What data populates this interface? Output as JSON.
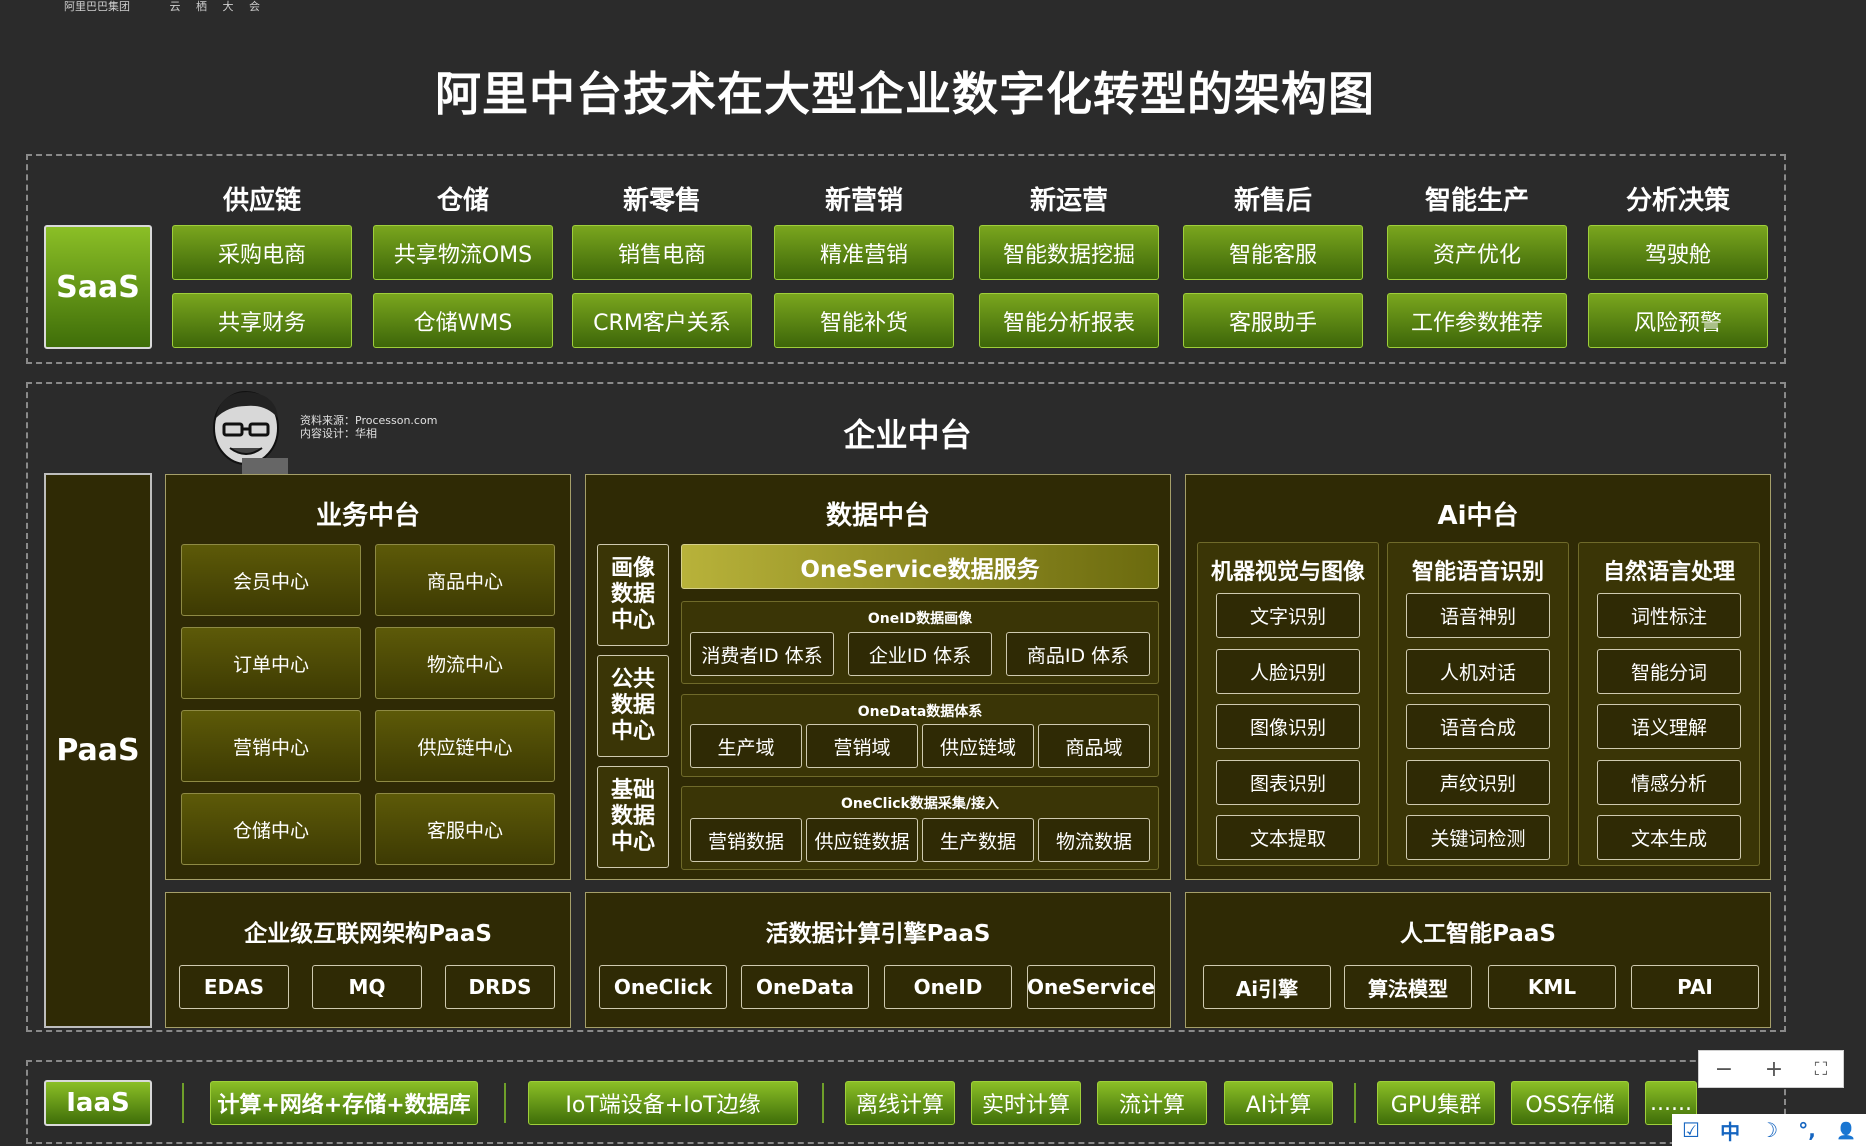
{
  "header": {
    "logo_main": "阿里巴巴集团",
    "logo_sub": "云 栖 大 会"
  },
  "title": "阿里中台技术在大型企业数字化转型的架构图",
  "saas": {
    "label": "SaaS",
    "columns": [
      {
        "head": "供应链",
        "items": [
          "采购电商",
          "共享财务"
        ]
      },
      {
        "head": "仓储",
        "items": [
          "共享物流OMS",
          "仓储WMS"
        ]
      },
      {
        "head": "新零售",
        "items": [
          "销售电商",
          "CRM客户关系"
        ]
      },
      {
        "head": "新营销",
        "items": [
          "精准营销",
          "智能补货"
        ]
      },
      {
        "head": "新运营",
        "items": [
          "智能数据挖掘",
          "智能分析报表"
        ]
      },
      {
        "head": "新售后",
        "items": [
          "智能客服",
          "客服助手"
        ]
      },
      {
        "head": "智能生产",
        "items": [
          "资产优化",
          "工作参数推荐"
        ]
      },
      {
        "head": "分析决策",
        "items": [
          "驾驶舱",
          "风险预警"
        ]
      }
    ]
  },
  "enterprise": {
    "title": "企业中台",
    "source_line1": "资料来源：Processon.com",
    "source_line2": "内容设计：华相",
    "paas_label": "PaaS",
    "business": {
      "title": "业务中台",
      "items": [
        "会员中心",
        "商品中心",
        "订单中心",
        "物流中心",
        "营销中心",
        "供应链中心",
        "仓储中心",
        "客服中心"
      ]
    },
    "data": {
      "title": "数据中台",
      "side": [
        "画像数据中心",
        "公共数据中心",
        "基础数据中心"
      ],
      "oneservice": "OneService数据服务",
      "oneid_head": "OneID数据画像",
      "oneid_items": [
        "消费者ID 体系",
        "企业ID 体系",
        "商品ID 体系"
      ],
      "onedata_head": "OneData数据体系",
      "onedata_items": [
        "生产域",
        "营销域",
        "供应链域",
        "商品域"
      ],
      "oneclick_head": "OneClick数据采集/接入",
      "oneclick_items": [
        "营销数据",
        "供应链数据",
        "生产数据",
        "物流数据"
      ]
    },
    "ai": {
      "title": "Ai中台",
      "columns": [
        {
          "head": "机器视觉与图像",
          "items": [
            "文字识别",
            "人脸识别",
            "图像识别",
            "图表识别",
            "文本提取"
          ]
        },
        {
          "head": "智能语音识别",
          "items": [
            "语音神别",
            "人机对话",
            "语音合成",
            "声纹识别",
            "关键词检测"
          ]
        },
        {
          "head": "自然语言处理",
          "items": [
            "词性标注",
            "智能分词",
            "语义理解",
            "情感分析",
            "文本生成"
          ]
        }
      ]
    },
    "paas_rows": [
      {
        "title": "企业级互联网架构PaaS",
        "items": [
          "EDAS",
          "MQ",
          "DRDS"
        ]
      },
      {
        "title": "活数据计算引擎PaaS",
        "items": [
          "OneClick",
          "OneData",
          "OneID",
          "OneService"
        ]
      },
      {
        "title": "人工智能PaaS",
        "items": [
          "Ai引擎",
          "算法模型",
          "KML",
          "PAI"
        ]
      }
    ]
  },
  "iaas": {
    "label": "IaaS",
    "group1": [
      "计算+网络+存储+数据库"
    ],
    "group2": [
      "IoT端设备+IoT边缘"
    ],
    "group3": [
      "离线计算",
      "实时计算",
      "流计算",
      "AI计算"
    ],
    "group4": [
      "GPU集群",
      "OSS存储",
      "......"
    ]
  },
  "controls": {
    "zoom_out": "−",
    "zoom_in": "+",
    "fit": "⛶",
    "ime": [
      "☑",
      "中",
      "☽",
      "°,",
      "👤"
    ]
  },
  "colors": {
    "saas_green": "#5a8d14",
    "panel_olive": "#2f2a05",
    "background": "#2b2b2b"
  }
}
